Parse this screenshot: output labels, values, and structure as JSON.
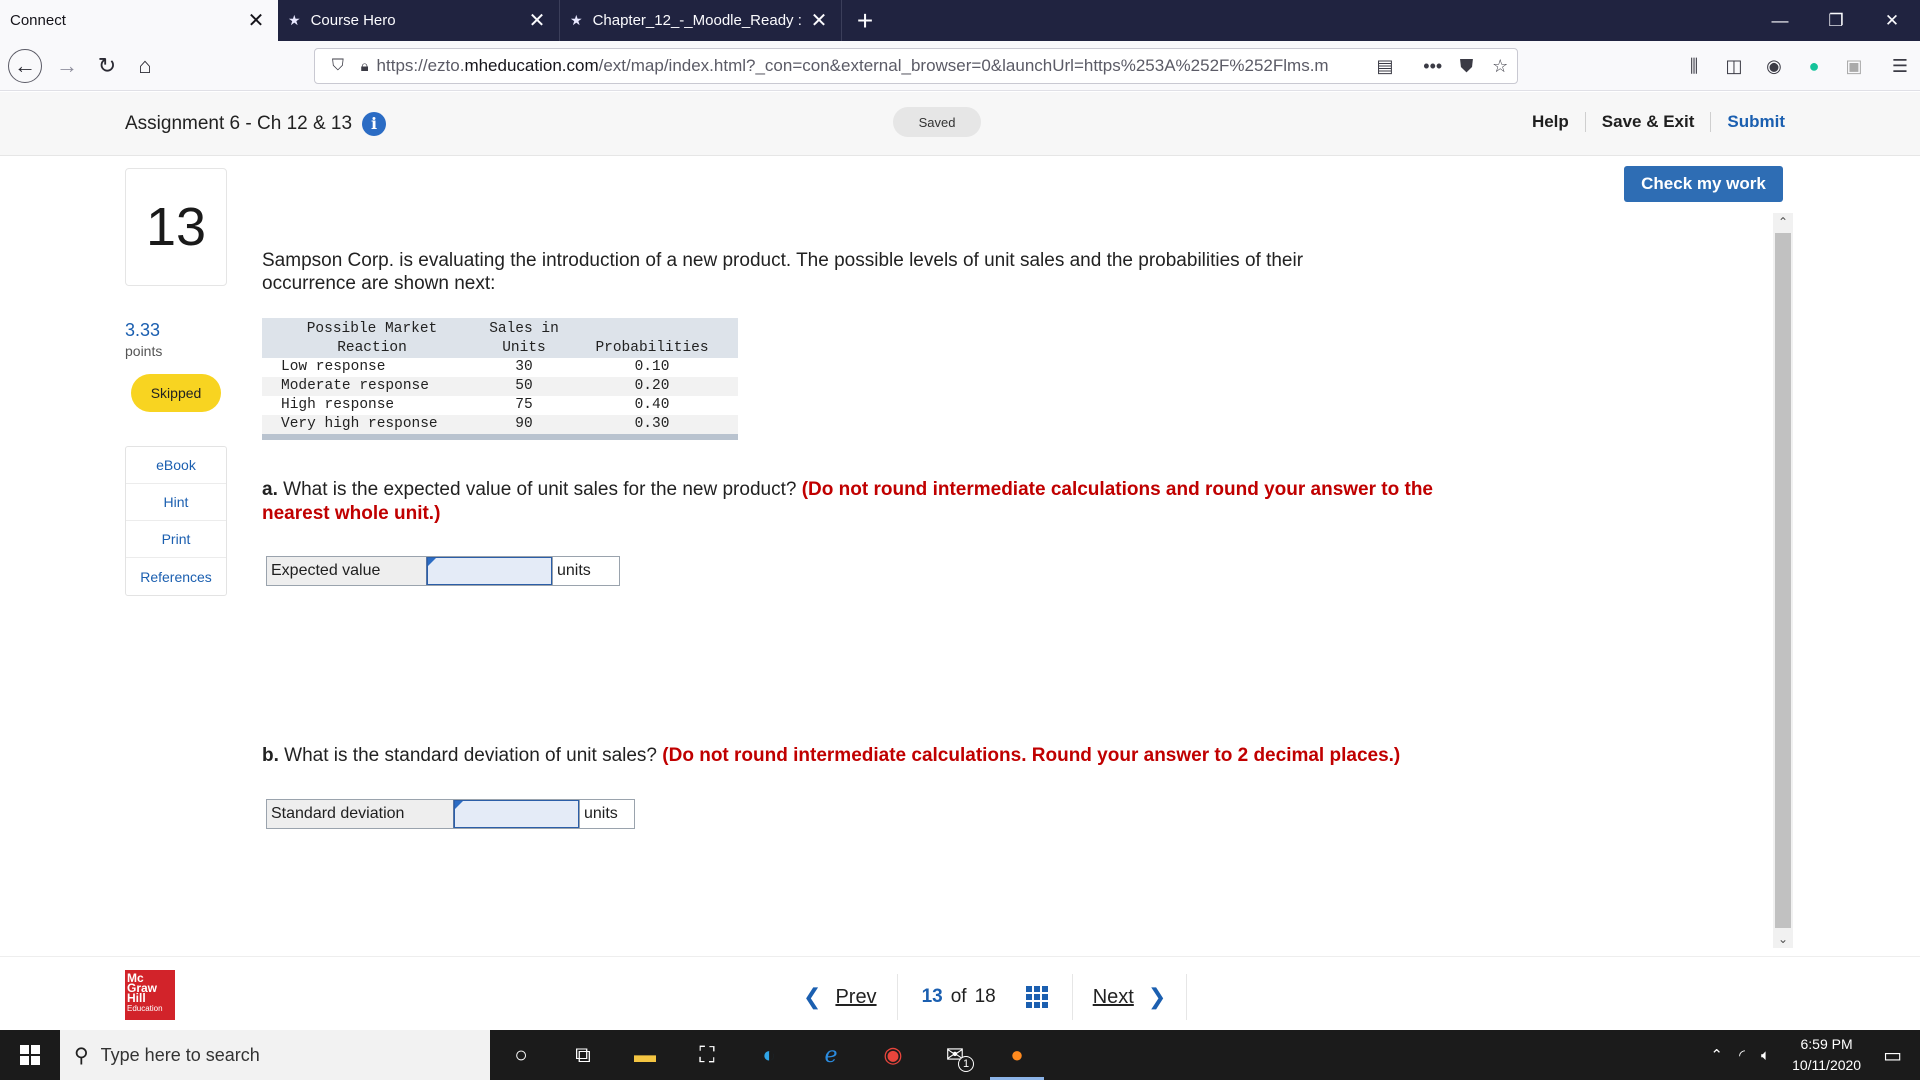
{
  "browser": {
    "tabs": [
      {
        "title": "Connect",
        "active": true
      },
      {
        "title": "Course Hero",
        "active": false
      },
      {
        "title": "Chapter_12_-_Moodle_Ready :",
        "active": false
      }
    ],
    "url_prefix": "https://ezto.",
    "url_domain": "mheducation.com",
    "url_rest": "/ext/map/index.html?_con=con&external_browser=0&launchUrl=https%253A%252F%252Flms.m"
  },
  "header": {
    "assignment_title": "Assignment 6 - Ch 12 & 13",
    "saved_label": "Saved",
    "help_label": "Help",
    "save_exit_label": "Save & Exit",
    "submit_label": "Submit"
  },
  "sidebar": {
    "question_number": "13",
    "points_value": "3.33",
    "points_label": "points",
    "status_badge": "Skipped",
    "links": [
      {
        "label": "eBook"
      },
      {
        "label": "Hint"
      },
      {
        "label": "Print"
      },
      {
        "label": "References"
      }
    ]
  },
  "check_work_label": "Check my work",
  "question": {
    "intro": "Sampson Corp. is evaluating the introduction of a new product. The possible levels of unit sales and the probabilities of their occurrence are shown next:",
    "table": {
      "headers": {
        "reaction_line1": "Possible Market",
        "reaction_line2": "Reaction",
        "units_line1": "Sales in",
        "units_line2": "Units",
        "prob": "Probabilities"
      },
      "rows": [
        {
          "reaction": "Low response",
          "units": "30",
          "prob": "0.10"
        },
        {
          "reaction": "Moderate response",
          "units": "50",
          "prob": "0.20"
        },
        {
          "reaction": "High response",
          "units": "75",
          "prob": "0.40"
        },
        {
          "reaction": "Very high response",
          "units": "90",
          "prob": "0.30"
        }
      ]
    },
    "part_a": {
      "letter": "a.",
      "text": " What is the expected value of unit sales for the new product? ",
      "instruction": "(Do not round intermediate calculations and round your answer to the nearest whole unit.)",
      "answer_label": "Expected value",
      "answer_value": "",
      "unit": "units"
    },
    "part_b": {
      "letter": "b.",
      "text": " What is the standard deviation of unit sales? ",
      "instruction": "(Do not round intermediate calculations. Round your answer to 2 decimal places.)",
      "answer_label": "Standard deviation",
      "answer_value": "",
      "unit": "units"
    }
  },
  "footer": {
    "logo_lines": [
      "Mc",
      "Graw",
      "Hill",
      "Education"
    ],
    "prev_label": "Prev",
    "current_page": "13",
    "of_label": "of",
    "total_pages": "18",
    "next_label": "Next"
  },
  "taskbar": {
    "search_placeholder": "Type here to search",
    "mail_badge": "1",
    "time": "6:59 PM",
    "date": "10/11/2020"
  }
}
